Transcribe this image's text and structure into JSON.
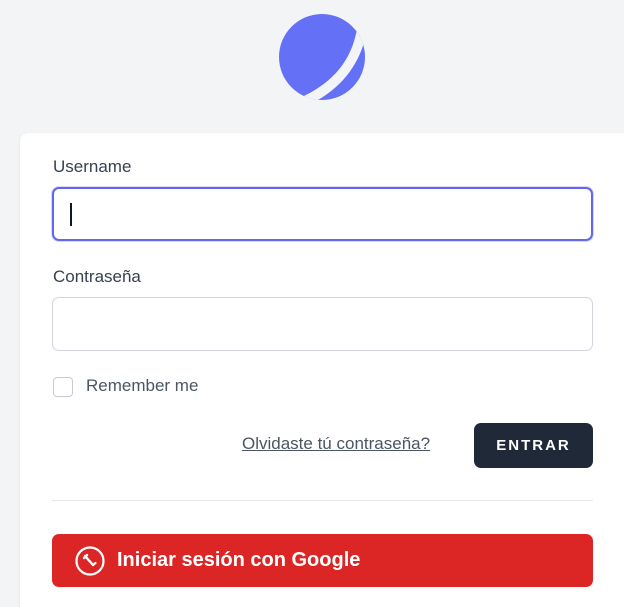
{
  "login": {
    "username_label": "Username",
    "password_label": "Contraseña",
    "username_value": "",
    "password_value": "",
    "remember_label": "Remember me",
    "remember_checked": false,
    "forgot_link": "Olvidaste tú contraseña?",
    "submit_label": "ENTRAR",
    "google_label": "Iniciar sesión con Google"
  },
  "colors": {
    "background": "#f3f4f6",
    "logo": "#6470f6",
    "focus_ring": "#6366f1",
    "submit_bg": "#1f2937",
    "google_bg": "#dc2626"
  },
  "icons": {
    "logo": "moon-logo-icon",
    "google": "google-icon"
  }
}
